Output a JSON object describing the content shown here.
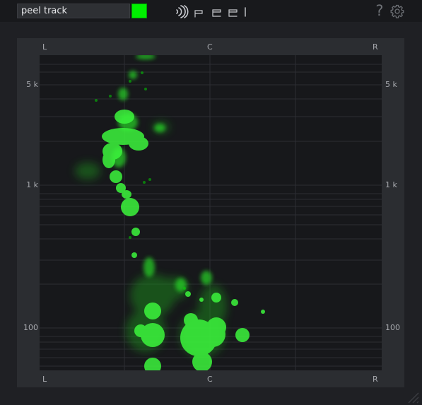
{
  "track_selector": {
    "value": "peel track"
  },
  "track_color": {
    "hex": "#00f000"
  },
  "logo": {
    "name": "peel-logo-icon",
    "text": "peel"
  },
  "toolbar": {
    "help_label": "?",
    "settings_icon": "gear-icon"
  },
  "pan_axis": {
    "top": [
      "L",
      "C",
      "R"
    ],
    "bottom": [
      "L",
      "C",
      "R"
    ]
  },
  "frequency_axis": {
    "left": [
      "5 k",
      "1 k",
      "100"
    ],
    "right": [
      "5 k",
      "1 k",
      "100"
    ]
  },
  "colors": {
    "accent": "#00f000",
    "plot_bg": "#17181b",
    "panel_bg": "#2b2d31"
  }
}
